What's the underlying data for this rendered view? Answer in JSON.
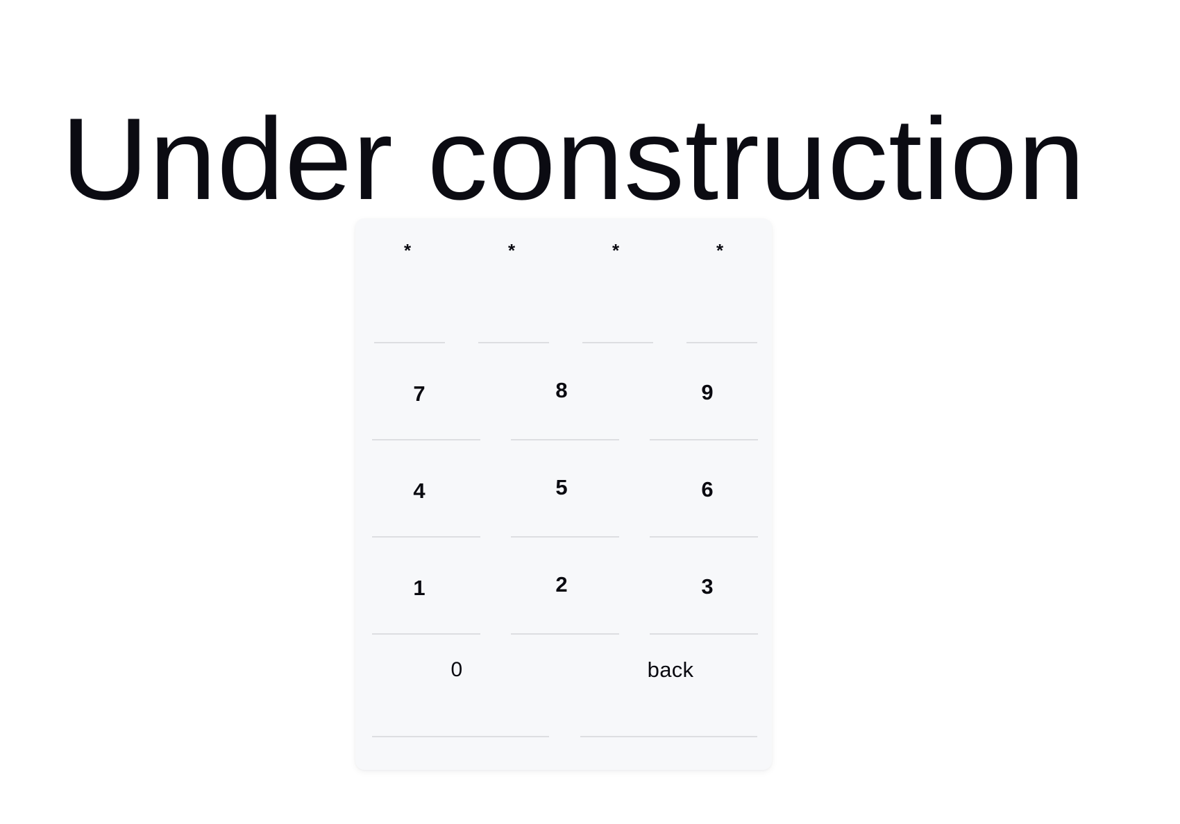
{
  "page": {
    "title": "Under construction",
    "background_color": "#ffffff",
    "text_color": "#0b0b12"
  },
  "keypad": {
    "card_background": "#f7f8fa",
    "separator_color": "#dddee1",
    "pin_display": {
      "mask_character": "*",
      "length": 4,
      "cells": [
        "*",
        "*",
        "*",
        "*"
      ]
    },
    "keys": [
      {
        "label": "7",
        "value": "7"
      },
      {
        "label": "8",
        "value": "8"
      },
      {
        "label": "9",
        "value": "9"
      },
      {
        "label": "4",
        "value": "4"
      },
      {
        "label": "5",
        "value": "5"
      },
      {
        "label": "6",
        "value": "6"
      },
      {
        "label": "1",
        "value": "1"
      },
      {
        "label": "2",
        "value": "2"
      },
      {
        "label": "3",
        "value": "3"
      }
    ],
    "bottom_keys": [
      {
        "label": "0",
        "value": "0"
      },
      {
        "label": "back",
        "value": "back"
      }
    ]
  }
}
